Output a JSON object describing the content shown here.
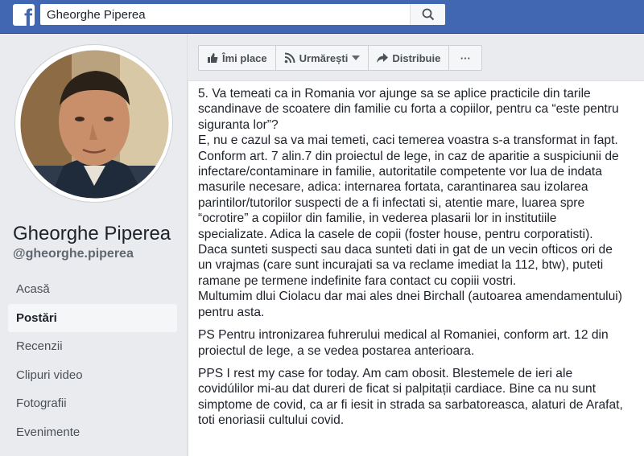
{
  "header": {
    "logo_glyph": "f",
    "search_value": "Gheorghe Piperea",
    "search_icon": "search-icon"
  },
  "profile": {
    "name": "Gheorghe Piperea",
    "handle": "@gheorghe.piperea"
  },
  "nav": {
    "items": [
      {
        "label": "Acasă"
      },
      {
        "label": "Postări",
        "active": true
      },
      {
        "label": "Recenzii"
      },
      {
        "label": "Clipuri video"
      },
      {
        "label": "Fotografii"
      },
      {
        "label": "Evenimente"
      }
    ]
  },
  "actions": {
    "like": "Îmi place",
    "follow": "Urmărești",
    "share": "Distribuie",
    "more": "···"
  },
  "post": {
    "lines": [
      "5. Va temeati ca in Romania vor ajunge sa se aplice practicile din tarile",
      "scandinave de scoatere din familie cu forta a copiilor, pentru ca “este pentru",
      "siguranta lor”?",
      "E, nu e cazul sa va mai temeti, caci temerea voastra s-a transformat in fapt.",
      "Conform art. 7 alin.7 din proiectul de lege, in caz de aparitie a suspiciunii de",
      "infectare/contaminare in familie, autoritatile competente vor lua de indata",
      "masurile necesare, adica: internarea fortata, carantinarea sau izolarea",
      "parintilor/tutorilor suspecti de a fi infectati si, atentie mare, luarea spre",
      "“ocrotire” a copiilor din familie, in vederea plasarii lor in institutiile",
      "specializate. Adica la casele de copii (foster house, pentru corporatisti).",
      "Daca sunteti suspecti sau daca sunteti dati in gat de un vecin ofticos ori de",
      "un vrajmas (care sunt incurajati sa va reclame imediat la 112, btw), puteti",
      "ramane pe termene indefinite fara contact cu copiii vostri.",
      "Multumim dlui Ciolacu dar mai ales dnei Birchall (autoarea amendamentului)",
      "pentru asta."
    ],
    "ps_lines": [
      "PS Pentru intronizarea fuhrerului medical al Romaniei, conform art. 12 din",
      "proiectul de lege, a se vedea postarea anterioara."
    ],
    "pps_lines": [
      "PPS I rest my case for today. Am cam obosit. Blestemele de ieri ale",
      "covidúlilor mi-au dat dureri de ficat si palpitații cardiace. Bine ca nu sunt",
      "simptome de covid, ca ar fi iesit in strada sa sarbatoreasca, alaturi de Arafat,",
      "toti enoriasii cultului covid."
    ]
  },
  "colors": {
    "brand_blue": "#4267b2",
    "page_bg": "#e9ebee",
    "text": "#1d2129"
  }
}
